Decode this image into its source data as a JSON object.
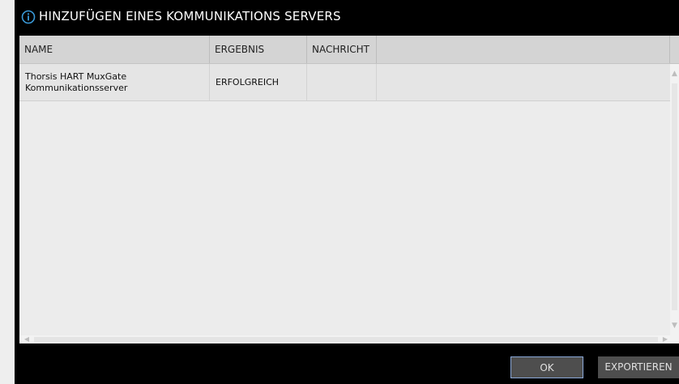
{
  "dialog": {
    "title": "HINZUFÜGEN EINES KOMMUNIKATIONS SERVERS",
    "title_icon": "info-circle-icon"
  },
  "table": {
    "columns": [
      "NAME",
      "ERGEBNIS",
      "NACHRICHT",
      ""
    ],
    "rows": [
      {
        "name_line1": "Thorsis HART MuxGate",
        "name_line2": "Kommunikationsserver",
        "result": "ERFOLGREICH",
        "message": ""
      }
    ]
  },
  "buttons": {
    "ok": "OK",
    "export": "EXPORTIEREN"
  },
  "colors": {
    "title_bar": "#000000",
    "accent_icon": "#3a9ad9",
    "header_bg": "#d4d4d4",
    "row_bg": "#e5e5e5",
    "button_bg": "#4e4e4e",
    "ok_border": "#8aa8d8"
  }
}
